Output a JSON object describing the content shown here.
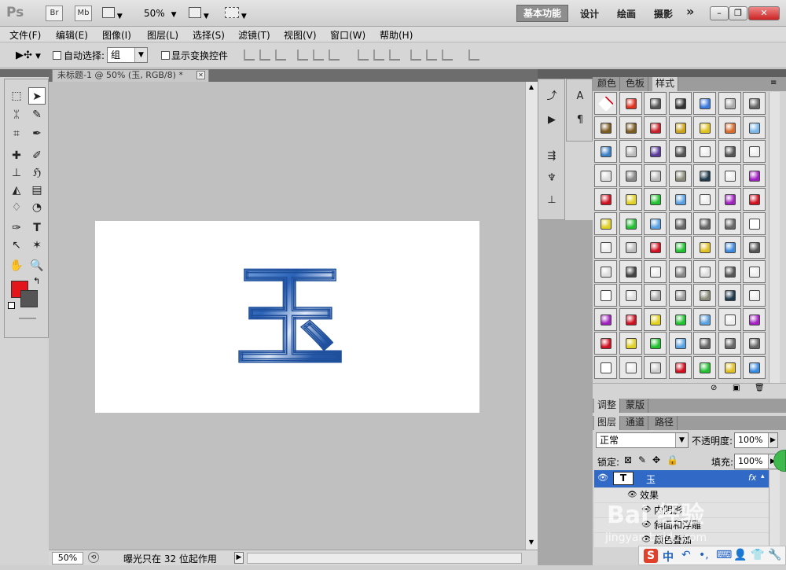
{
  "app": {
    "logo": "Ps",
    "bridge_label": "Br",
    "minibridge_label": "Mb",
    "zoom_value": "50%",
    "workspaces": [
      "基本功能",
      "设计",
      "绘画",
      "摄影"
    ],
    "more_workspaces": "»"
  },
  "menu": [
    "文件(F)",
    "编辑(E)",
    "图像(I)",
    "图层(L)",
    "选择(S)",
    "滤镜(T)",
    "视图(V)",
    "窗口(W)",
    "帮助(H)"
  ],
  "options": {
    "auto_select_label": "自动选择:",
    "auto_select_value": "组",
    "show_transform_label": "显示变换控件"
  },
  "document": {
    "tab_title": "未标题-1 @ 50% (玉, RGB/8) *",
    "canvas_text": "玉",
    "zoom": "50%",
    "status_text": "曝光只在 32 位起作用"
  },
  "colors": {
    "foreground": "#e4141b",
    "background": "#555555",
    "accent": "#3169c6"
  },
  "styles_panel": {
    "tabs": [
      "颜色",
      "色板",
      "样式"
    ],
    "active_tab": "样式"
  },
  "adjust_panel": {
    "tabs": [
      "调整",
      "蒙版"
    ]
  },
  "layers_panel": {
    "tabs": [
      "图层",
      "通道",
      "路径"
    ],
    "blend_mode": "正常",
    "opacity_label": "不透明度:",
    "opacity_value": "100%",
    "lock_label": "锁定:",
    "fill_label": "填充:",
    "fill_value": "100%",
    "layer_name": "玉",
    "layer_thumb": "T",
    "fx_label": "fx",
    "effects_label": "效果",
    "effect_items": [
      "内阴影",
      "斜面和浮雕",
      "颜色叠加"
    ]
  },
  "ime": {
    "logo": "S",
    "lang": "中"
  },
  "watermark": {
    "brand": "Bai 经验",
    "url": "jingyan.baidu.com"
  }
}
